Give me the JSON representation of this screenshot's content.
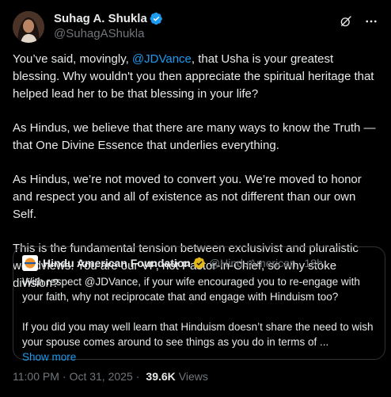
{
  "author": {
    "name": "Suhag A. Shukla",
    "handle": "@SuhagAShukla"
  },
  "header": {
    "grok_icon": "grok-icon",
    "more_icon": "more-icon"
  },
  "post": {
    "p1_pre": "You’ve said, movingly, ",
    "p1_mention": "@JDVance",
    "p1_post": ", that Usha is your greatest blessing. Why wouldn't you then appreciate the spiritual heritage that helped lead her to be that blessing in your life?",
    "p2": "As Hindus, we believe that there are many ways to know the Truth — that One Divine Essence that underlies everything.",
    "p3": "As Hindus, we’re not moved to convert you. We’re moved to honor and respect you and all of existence as not different than our own Self.",
    "p4": "This is the fundamental tension between exclusivist and pluralistic worldviews. You are our VP, not Pastor-in-Chief, so why stoke division?"
  },
  "quote": {
    "name": "Hindu American Foundation",
    "handle": "@HinduAmerican",
    "time": "18h",
    "p1": "With respect @JDVance, if your wife encouraged you to re-engage with your faith, why not reciprocate that and engage with Hinduism too?",
    "p2": "If you did you may well learn that Hinduism doesn’t share the need to wish your spouse comes around to see things as you do in terms of ...",
    "show_more": "Show more"
  },
  "meta": {
    "time": "11:00 PM",
    "date": "Oct 31, 2025",
    "separator": "·",
    "views_count": "39.6K",
    "views_label": "Views"
  },
  "colors": {
    "background": "#000000",
    "text": "#e7e9ea",
    "muted": "#71767b",
    "accent": "#1d9bf0",
    "border": "#2f3336"
  }
}
